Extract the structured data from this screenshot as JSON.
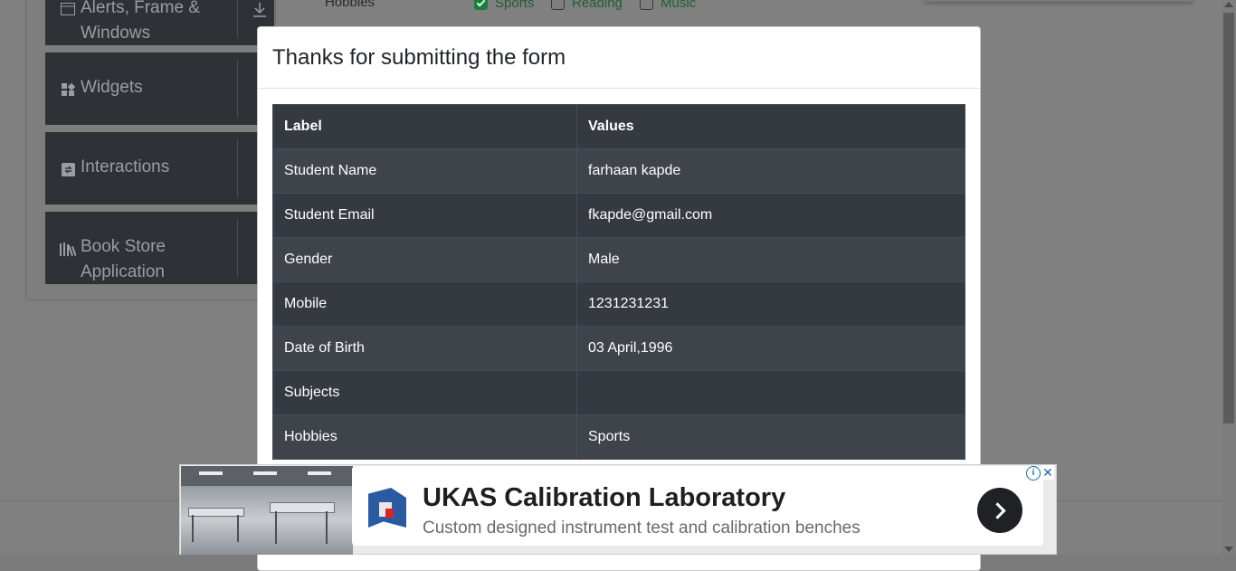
{
  "background": {
    "sidebar_groups": [
      {
        "label_line1": "Alerts, Frame &",
        "label_line2": "Windows",
        "icon": "window-icon"
      },
      {
        "label_line1": "Widgets",
        "icon": "widgets-icon"
      },
      {
        "label_line1": "Interactions",
        "icon": "interactions-icon"
      },
      {
        "label_line1": "Book Store",
        "label_line2": "Application",
        "icon": "book-icon"
      }
    ],
    "hobbies_label": "Hobbies",
    "hobby_options": [
      {
        "label": "Sports",
        "checked": true
      },
      {
        "label": "Reading",
        "checked": false
      },
      {
        "label": "Music",
        "checked": false
      }
    ]
  },
  "modal": {
    "title": "Thanks for submitting the form",
    "table": {
      "headers": [
        "Label",
        "Values"
      ],
      "rows": [
        {
          "label": "Student Name",
          "value": "farhaan kapde"
        },
        {
          "label": "Student Email",
          "value": "fkapde@gmail.com"
        },
        {
          "label": "Gender",
          "value": "Male"
        },
        {
          "label": "Mobile",
          "value": "1231231231"
        },
        {
          "label": "Date of Birth",
          "value": "03 April,1996"
        },
        {
          "label": "Subjects",
          "value": ""
        },
        {
          "label": "Hobbies",
          "value": "Sports"
        }
      ]
    }
  },
  "ad": {
    "title": "UKAS Calibration Laboratory",
    "subtitle": "Custom designed instrument test and calibration benches",
    "info_glyph": "i",
    "close_glyph": "✕"
  },
  "colors": {
    "table_dark": "#343a40",
    "table_stripe": "#3e444a",
    "overlay": "#808080",
    "checkbox_green": "#1f7a3a"
  }
}
